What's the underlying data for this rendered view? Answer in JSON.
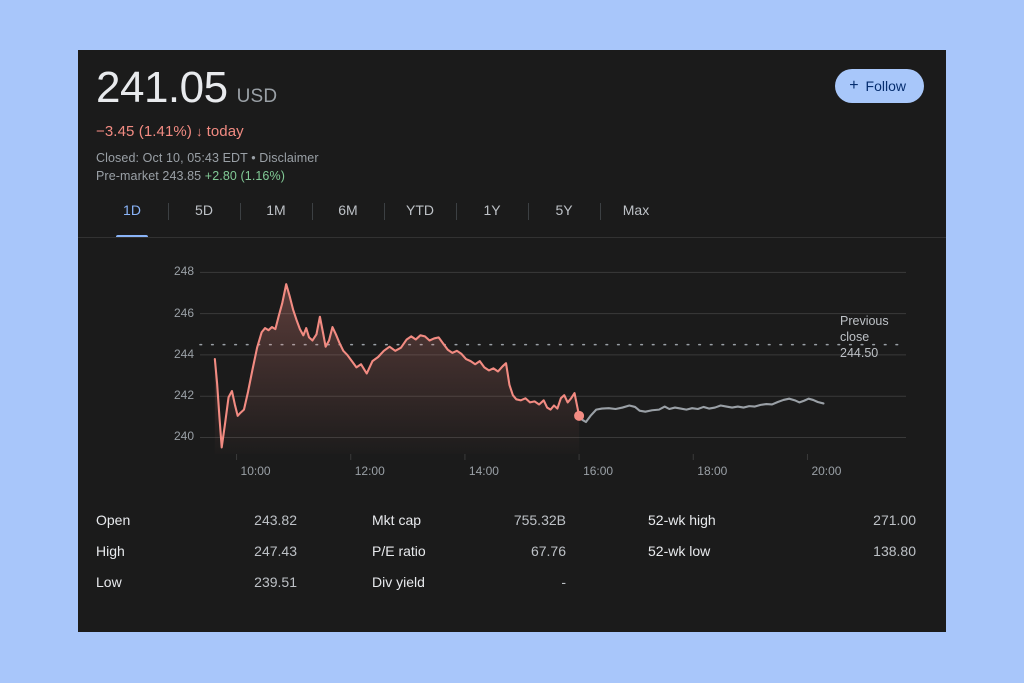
{
  "quote": {
    "price": "241.05",
    "currency": "USD",
    "change": "−3.45 (1.41%)",
    "change_arrow": "↓",
    "change_period": "today",
    "change_color": "#f28b82",
    "status_line": "Closed: Oct 10, 05:43 EDT • ",
    "disclaimer": "Disclaimer",
    "premarket_label": "Pre-market 243.85 ",
    "premarket_change": "+2.80 (1.16%)",
    "premarket_color": "#81c995"
  },
  "follow": {
    "label": "Follow",
    "plus": "+",
    "bg": "#a8c7fa",
    "fg": "#062e6f"
  },
  "tabs": [
    {
      "label": "1D",
      "active": true
    },
    {
      "label": "5D",
      "active": false
    },
    {
      "label": "1M",
      "active": false
    },
    {
      "label": "6M",
      "active": false
    },
    {
      "label": "YTD",
      "active": false
    },
    {
      "label": "1Y",
      "active": false
    },
    {
      "label": "5Y",
      "active": false
    },
    {
      "label": "Max",
      "active": false
    }
  ],
  "chart_annotations": {
    "prev_close_line1": "Previous",
    "prev_close_line2": "close",
    "prev_close_line3": "244.50"
  },
  "chart_data": {
    "type": "line",
    "title": "",
    "xlabel": "",
    "ylabel": "",
    "ylim": [
      239.2,
      248.6
    ],
    "xlim": [
      9.5,
      20.5
    ],
    "grid": true,
    "ytick_values": [
      248,
      246,
      244,
      242,
      240
    ],
    "ytick_labels": [
      "248",
      "246",
      "244",
      "242",
      "240"
    ],
    "xtick_values": [
      10,
      12,
      14,
      16,
      18,
      20
    ],
    "xtick_labels": [
      "10:00",
      "12:00",
      "14:00",
      "16:00",
      "18:00",
      "20:00"
    ],
    "reference_line": {
      "label": "Previous close",
      "value": 244.5,
      "style": "dotted",
      "color": "#9aa0a6"
    },
    "line_color": "#f28b82",
    "afterhours_color": "#9aa0a6",
    "fill": true,
    "marker": {
      "x": 16.0,
      "y": 241.05,
      "color": "#f28b82"
    },
    "series": [
      {
        "name": "Regular hours",
        "color": "#f28b82",
        "points": [
          [
            9.62,
            243.8
          ],
          [
            9.66,
            242.6
          ],
          [
            9.7,
            241.0
          ],
          [
            9.74,
            239.52
          ],
          [
            9.8,
            240.7
          ],
          [
            9.86,
            241.95
          ],
          [
            9.92,
            242.25
          ],
          [
            9.97,
            241.6
          ],
          [
            10.02,
            241.05
          ],
          [
            10.07,
            241.2
          ],
          [
            10.13,
            241.35
          ],
          [
            10.2,
            242.2
          ],
          [
            10.28,
            243.3
          ],
          [
            10.36,
            244.35
          ],
          [
            10.44,
            245.1
          ],
          [
            10.5,
            245.3
          ],
          [
            10.56,
            245.2
          ],
          [
            10.62,
            245.35
          ],
          [
            10.68,
            245.25
          ],
          [
            10.74,
            245.9
          ],
          [
            10.8,
            246.5
          ],
          [
            10.87,
            247.43
          ],
          [
            10.93,
            246.85
          ],
          [
            10.99,
            246.2
          ],
          [
            11.05,
            245.7
          ],
          [
            11.11,
            245.25
          ],
          [
            11.17,
            244.95
          ],
          [
            11.22,
            245.3
          ],
          [
            11.27,
            244.85
          ],
          [
            11.33,
            244.7
          ],
          [
            11.4,
            245.0
          ],
          [
            11.46,
            245.85
          ],
          [
            11.52,
            245.0
          ],
          [
            11.56,
            244.4
          ],
          [
            11.62,
            244.7
          ],
          [
            11.68,
            245.35
          ],
          [
            11.74,
            245.0
          ],
          [
            11.8,
            244.6
          ],
          [
            11.87,
            244.2
          ],
          [
            11.94,
            244.0
          ],
          [
            12.02,
            243.7
          ],
          [
            12.1,
            243.4
          ],
          [
            12.18,
            243.55
          ],
          [
            12.28,
            243.1
          ],
          [
            12.38,
            243.7
          ],
          [
            12.48,
            243.9
          ],
          [
            12.58,
            244.2
          ],
          [
            12.68,
            244.4
          ],
          [
            12.78,
            244.2
          ],
          [
            12.88,
            244.35
          ],
          [
            12.98,
            244.75
          ],
          [
            13.06,
            244.9
          ],
          [
            13.14,
            244.75
          ],
          [
            13.22,
            244.95
          ],
          [
            13.3,
            244.9
          ],
          [
            13.38,
            244.7
          ],
          [
            13.46,
            244.8
          ],
          [
            13.54,
            244.85
          ],
          [
            13.62,
            244.55
          ],
          [
            13.7,
            244.25
          ],
          [
            13.78,
            244.1
          ],
          [
            13.86,
            244.2
          ],
          [
            13.94,
            244.05
          ],
          [
            14.02,
            243.8
          ],
          [
            14.1,
            243.7
          ],
          [
            14.18,
            243.55
          ],
          [
            14.26,
            243.7
          ],
          [
            14.34,
            243.4
          ],
          [
            14.42,
            243.25
          ],
          [
            14.5,
            243.35
          ],
          [
            14.58,
            243.2
          ],
          [
            14.66,
            243.45
          ],
          [
            14.72,
            243.6
          ],
          [
            14.78,
            242.55
          ],
          [
            14.84,
            242.05
          ],
          [
            14.9,
            241.85
          ],
          [
            14.98,
            241.8
          ],
          [
            15.06,
            241.9
          ],
          [
            15.14,
            241.7
          ],
          [
            15.22,
            241.75
          ],
          [
            15.3,
            241.6
          ],
          [
            15.38,
            241.8
          ],
          [
            15.44,
            241.45
          ],
          [
            15.5,
            241.35
          ],
          [
            15.56,
            241.55
          ],
          [
            15.62,
            241.4
          ],
          [
            15.68,
            241.9
          ],
          [
            15.74,
            242.05
          ],
          [
            15.8,
            241.7
          ],
          [
            15.86,
            241.9
          ],
          [
            15.92,
            242.15
          ],
          [
            15.96,
            241.6
          ],
          [
            16.0,
            241.05
          ]
        ]
      },
      {
        "name": "After hours",
        "color": "#9aa0a6",
        "points": [
          [
            16.0,
            241.05
          ],
          [
            16.06,
            240.85
          ],
          [
            16.12,
            240.75
          ],
          [
            16.2,
            241.05
          ],
          [
            16.3,
            241.35
          ],
          [
            16.4,
            241.4
          ],
          [
            16.52,
            241.42
          ],
          [
            16.64,
            241.38
          ],
          [
            16.76,
            241.45
          ],
          [
            16.88,
            241.55
          ],
          [
            16.98,
            241.48
          ],
          [
            17.06,
            241.3
          ],
          [
            17.16,
            241.25
          ],
          [
            17.28,
            241.32
          ],
          [
            17.4,
            241.35
          ],
          [
            17.5,
            241.5
          ],
          [
            17.58,
            241.38
          ],
          [
            17.68,
            241.45
          ],
          [
            17.78,
            241.4
          ],
          [
            17.88,
            241.35
          ],
          [
            17.98,
            241.42
          ],
          [
            18.08,
            241.38
          ],
          [
            18.18,
            241.48
          ],
          [
            18.28,
            241.4
          ],
          [
            18.38,
            241.45
          ],
          [
            18.48,
            241.55
          ],
          [
            18.58,
            241.5
          ],
          [
            18.68,
            241.45
          ],
          [
            18.78,
            241.5
          ],
          [
            18.88,
            241.45
          ],
          [
            18.98,
            241.52
          ],
          [
            19.08,
            241.5
          ],
          [
            19.18,
            241.58
          ],
          [
            19.28,
            241.62
          ],
          [
            19.38,
            241.6
          ],
          [
            19.48,
            241.72
          ],
          [
            19.58,
            241.82
          ],
          [
            19.68,
            241.88
          ],
          [
            19.78,
            241.8
          ],
          [
            19.86,
            241.7
          ],
          [
            19.94,
            241.78
          ],
          [
            20.02,
            241.88
          ],
          [
            20.1,
            241.82
          ],
          [
            20.18,
            241.72
          ],
          [
            20.28,
            241.65
          ]
        ]
      }
    ]
  },
  "stats": {
    "columns": [
      {
        "rows": [
          {
            "label": "Open",
            "value": "243.82"
          },
          {
            "label": "High",
            "value": "247.43"
          },
          {
            "label": "Low",
            "value": "239.51"
          }
        ]
      },
      {
        "rows": [
          {
            "label": "Mkt cap",
            "value": "755.32B"
          },
          {
            "label": "P/E ratio",
            "value": "67.76"
          },
          {
            "label": "Div yield",
            "value": "-"
          }
        ]
      },
      {
        "rows": [
          {
            "label": "52-wk high",
            "value": "271.00"
          },
          {
            "label": "52-wk low",
            "value": "138.80"
          }
        ]
      }
    ]
  }
}
